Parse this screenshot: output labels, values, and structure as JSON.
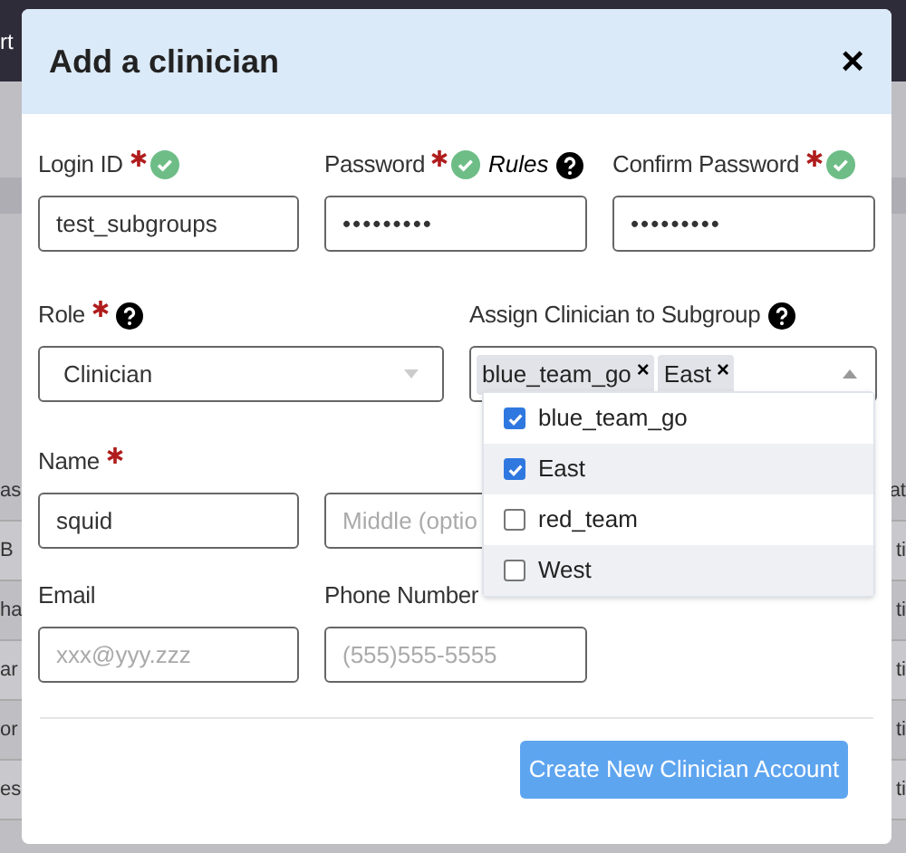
{
  "background": {
    "nav_fragment": "rt",
    "rows": [
      {
        "left": "as",
        "right": "at"
      },
      {
        "left": "B",
        "right": "ti"
      },
      {
        "left": "ha",
        "right": "ti"
      },
      {
        "left": "ar",
        "right": "ti"
      },
      {
        "left": "or",
        "right": "ti"
      },
      {
        "left": "es",
        "right": "ti"
      }
    ]
  },
  "dialog": {
    "title": "Add a clinician",
    "close": "×",
    "login": {
      "label": "Login ID",
      "required": true,
      "valid": true,
      "value": "test_subgroups"
    },
    "password": {
      "label": "Password",
      "required": true,
      "valid": true,
      "rules": "Rules",
      "value": "•••••••••"
    },
    "confirm": {
      "label": "Confirm Password",
      "required": true,
      "valid": true,
      "value": "•••••••••"
    },
    "role": {
      "label": "Role",
      "required": true,
      "value": "Clinician"
    },
    "subgroup": {
      "label": "Assign Clinician to Subgroup",
      "chips": [
        {
          "label": "blue_team_go",
          "remove": "×"
        },
        {
          "label": "East",
          "remove": "×"
        }
      ],
      "expanded": true,
      "options": [
        {
          "label": "blue_team_go",
          "checked": true
        },
        {
          "label": "East",
          "checked": true
        },
        {
          "label": "red_team",
          "checked": false
        },
        {
          "label": "West",
          "checked": false
        }
      ]
    },
    "name": {
      "label": "Name",
      "required": true,
      "first": "squid",
      "middle_placeholder": "Middle (optio"
    },
    "email": {
      "label": "Email",
      "placeholder": "xxx@yyy.zzz"
    },
    "phone": {
      "label": "Phone Number",
      "placeholder": "(555)555-5555"
    },
    "submit": "Create New Clinician Account"
  }
}
